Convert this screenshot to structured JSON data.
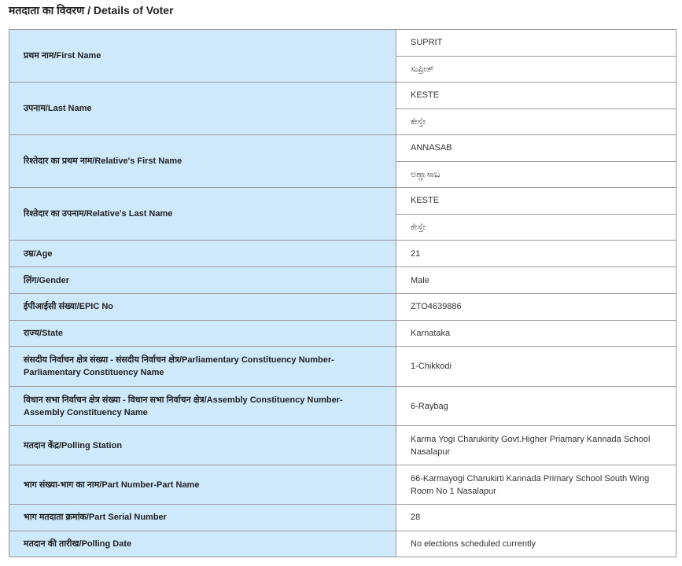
{
  "title": "मतदाता का विवरण / Details of Voter",
  "rows": [
    {
      "label": "प्रथम नाम/First Name",
      "values": [
        "SUPRIT",
        "ಸುಪ್ರೀತ್"
      ]
    },
    {
      "label": "उपनाम/Last Name",
      "values": [
        "KESTE",
        "ಕೇಸ್ತೇ"
      ]
    },
    {
      "label": "रिश्तेदार का प्रथम नाम/Relative's First Name",
      "values": [
        "ANNASAB",
        "ಅಣ್ಣಾಸಾಬ"
      ]
    },
    {
      "label": "रिश्तेदार का उपनाम/Relative's Last Name",
      "values": [
        "KESTE",
        "ಕೇಸ್ತೇ"
      ]
    },
    {
      "label": "उम्र/Age",
      "values": [
        "21"
      ]
    },
    {
      "label": "लिंग/Gender",
      "values": [
        "Male"
      ]
    },
    {
      "label": "ईपीआईसी संख्या/EPIC No",
      "values": [
        "ZTO4639886"
      ]
    },
    {
      "label": "राज्य/State",
      "values": [
        "Karnataka"
      ]
    },
    {
      "label": "संसदीय निर्वाचन क्षेत्र संख्या - संसदीय निर्वाचन क्षेत्र/Parliamentary Constituency Number-Parliamentary Constituency Name",
      "values": [
        "1-Chikkodi"
      ]
    },
    {
      "label": "विधान सभा निर्वाचन क्षेत्र संख्या - विधान सभा निर्वाचन क्षेत्र/Assembly Constituency Number-Assembly Constituency Name",
      "values": [
        "6-Raybag"
      ]
    },
    {
      "label": "मतदान केंद्र/Polling Station",
      "values": [
        "Karma Yogi Charukirity Govt.Higher Priamary Kannada School Nasalapur"
      ]
    },
    {
      "label": "भाग संख्या-भाग का नाम/Part Number-Part Name",
      "values": [
        "66-Karmayogi Charukirti Kannada Primary School South Wing Room No 1 Nasalapur"
      ]
    },
    {
      "label": "भाग मतदाता क्रमांक/Part Serial Number",
      "values": [
        "28"
      ]
    },
    {
      "label": "मतदान की तारीख/Polling Date",
      "values": [
        "No elections scheduled currently"
      ]
    }
  ]
}
